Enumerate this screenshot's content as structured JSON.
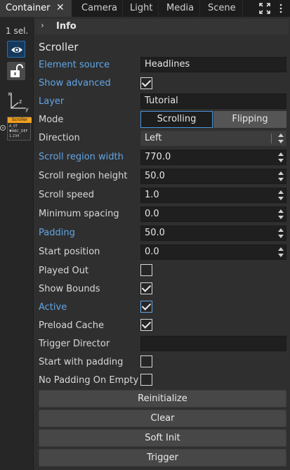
{
  "tabs": [
    {
      "label": "Container",
      "active": true
    },
    {
      "label": "Camera",
      "active": false
    },
    {
      "label": "Light",
      "active": false
    },
    {
      "label": "Media",
      "active": false
    },
    {
      "label": "Scene",
      "active": false
    }
  ],
  "tab_close_glyph": "✕",
  "maximize_icon": "expand-icon",
  "left": {
    "selection_count": "1 sel.",
    "thumbnail": {
      "title": "Scroller",
      "lines": [
        "A_0T",
        "▼ABC_DEF",
        "1.234"
      ]
    }
  },
  "info": {
    "title": "Info",
    "chevron": "›"
  },
  "section_title": "Scroller",
  "properties": {
    "element_source": {
      "label": "Element source",
      "value": "Headlines"
    },
    "show_advanced": {
      "label": "Show advanced",
      "checked": true
    },
    "layer": {
      "label": "Layer",
      "value": "Tutorial"
    },
    "mode": {
      "label": "Mode",
      "options": [
        "Scrolling",
        "Flipping"
      ],
      "selected": "Scrolling"
    },
    "direction": {
      "label": "Direction",
      "value": "Left"
    },
    "scroll_region_width": {
      "label": "Scroll region width",
      "value": "770.0"
    },
    "scroll_region_height": {
      "label": "Scroll region height",
      "value": "50.0"
    },
    "scroll_speed": {
      "label": "Scroll speed",
      "value": "1.0"
    },
    "minimum_spacing": {
      "label": "Minimum spacing",
      "value": "0.0"
    },
    "padding": {
      "label": "Padding",
      "value": "50.0"
    },
    "start_position": {
      "label": "Start position",
      "value": "0.0"
    },
    "played_out": {
      "label": "Played Out",
      "checked": false
    },
    "show_bounds": {
      "label": "Show Bounds",
      "checked": true
    },
    "active": {
      "label": "Active",
      "checked": true
    },
    "preload_cache": {
      "label": "Preload Cache",
      "checked": true
    },
    "trigger_director": {
      "label": "Trigger Director",
      "value": ""
    },
    "start_with_padding": {
      "label": "Start with padding",
      "checked": false
    },
    "no_padding_on_empty": {
      "label": "No Padding On Empty",
      "checked": false
    }
  },
  "buttons": {
    "reinitialize": "Reinitialize",
    "clear": "Clear",
    "soft_init": "Soft Init",
    "trigger": "Trigger"
  },
  "colors": {
    "modified_label": "#62a6e6",
    "selected_segment_border": "#4a94d8",
    "thumbnail_header": "#f0a020"
  }
}
